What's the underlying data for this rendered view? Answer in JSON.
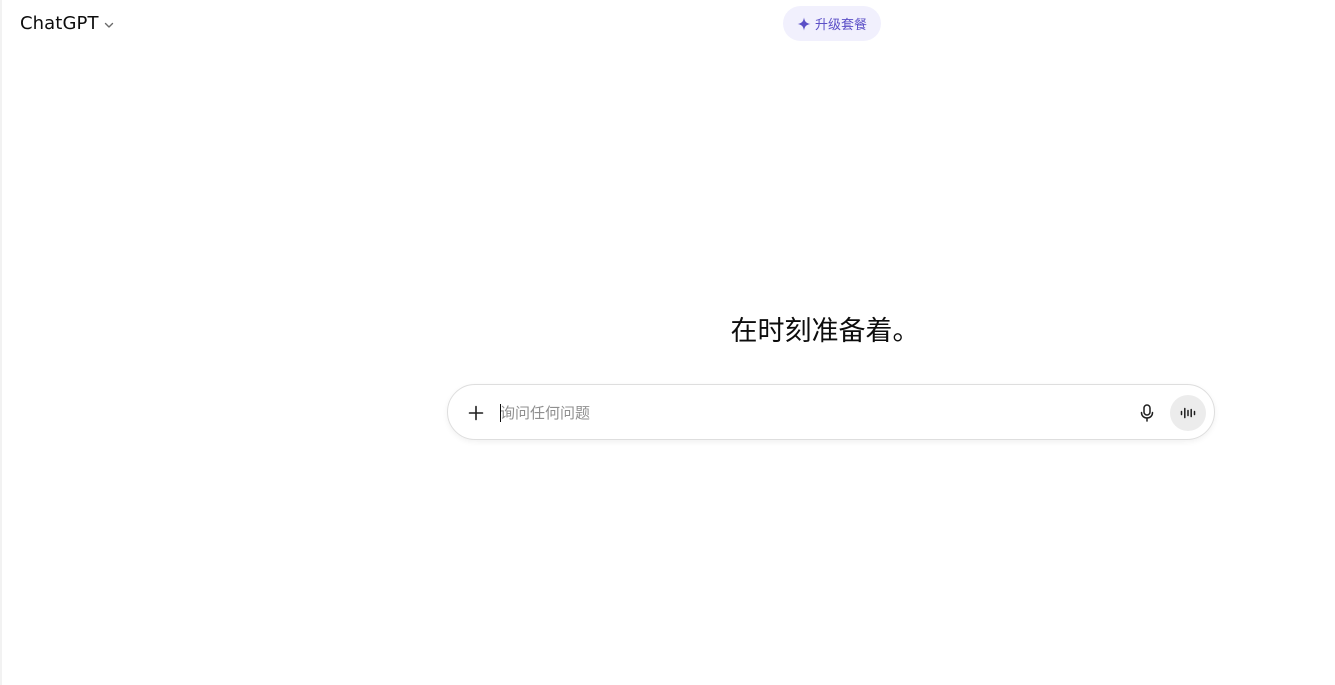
{
  "header": {
    "model_name": "ChatGPT",
    "model_menu_icon": "chevron-down-icon",
    "upgrade": {
      "label": "升级套餐",
      "icon": "sparkle-icon",
      "accent_color": "#5b4fc7",
      "background_color": "#f1f0fd"
    }
  },
  "main": {
    "headline": "在时刻准备着。"
  },
  "composer": {
    "placeholder": "询问任何问题",
    "value": "",
    "attach_icon": "plus-icon",
    "dictate_icon": "microphone-icon",
    "voice_mode_icon": "voice-waveform-icon"
  }
}
